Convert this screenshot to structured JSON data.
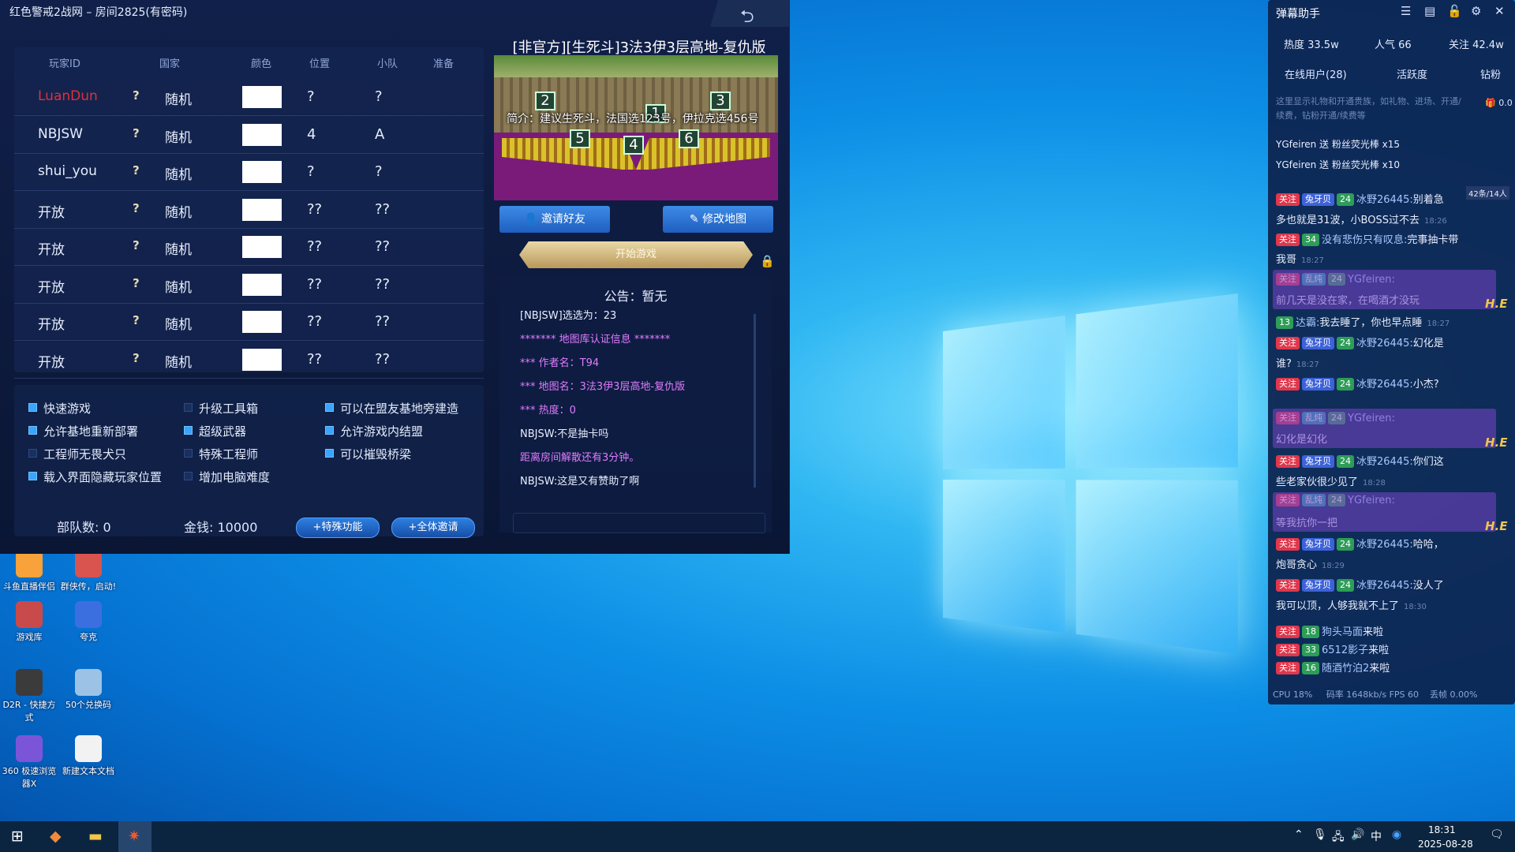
{
  "game": {
    "title": "红色警戒2战网 – 房间2825(有密码)",
    "columns": [
      "玩家ID",
      "国家",
      "颜色",
      "位置",
      "小队",
      "准备"
    ],
    "players": [
      {
        "id": "LuanDun",
        "flag": "?",
        "nation": "随机",
        "pos": "?",
        "team": "?"
      },
      {
        "id": "NBJSW",
        "flag": "?",
        "nation": "随机",
        "pos": "4",
        "team": "A"
      },
      {
        "id": "shui_you",
        "flag": "?",
        "nation": "随机",
        "pos": "?",
        "team": "?"
      },
      {
        "id": "开放",
        "flag": "?",
        "nation": "随机",
        "pos": "??",
        "team": "??"
      },
      {
        "id": "开放",
        "flag": "?",
        "nation": "随机",
        "pos": "??",
        "team": "??"
      },
      {
        "id": "开放",
        "flag": "?",
        "nation": "随机",
        "pos": "??",
        "team": "??"
      },
      {
        "id": "开放",
        "flag": "?",
        "nation": "随机",
        "pos": "??",
        "team": "??"
      },
      {
        "id": "开放",
        "flag": "?",
        "nation": "随机",
        "pos": "??",
        "team": "??"
      }
    ],
    "options": [
      {
        "label": "快速游戏",
        "on": true
      },
      {
        "label": "升级工具箱",
        "on": false
      },
      {
        "label": "可以在盟友基地旁建造",
        "on": true
      },
      {
        "label": "允许基地重新部署",
        "on": true
      },
      {
        "label": "超级武器",
        "on": true
      },
      {
        "label": "允许游戏内结盟",
        "on": true
      },
      {
        "label": "工程师无畏犬只",
        "on": false
      },
      {
        "label": "特殊工程师",
        "on": false
      },
      {
        "label": "可以摧毁桥梁",
        "on": true
      },
      {
        "label": "载入界面隐藏玩家位置",
        "on": true
      },
      {
        "label": "增加电脑难度",
        "on": false
      }
    ],
    "units": "部队数:  0",
    "money": "金钱:  10000",
    "special_btn": "+特殊功能",
    "invite_all_btn": "+全体邀请",
    "map_title": "[非官方][生死斗]3法3伊3层高地-复仇版",
    "map_desc": "简介：建议生死斗，法国选123号，伊拉克选456号",
    "map_numbers": [
      "2",
      "1",
      "3",
      "5",
      "4",
      "6"
    ],
    "invite_btn": "邀请好友",
    "edit_map_btn": "修改地图",
    "start_btn": "开始游戏",
    "notice": "公告：暂无",
    "chat": [
      {
        "text": "[NBJSW]选选为：23",
        "cls": "white"
      },
      {
        "text": "******* 地图库认证信息 *******",
        "cls": "pink"
      },
      {
        "text": "*** 作者名：T94",
        "cls": "pink"
      },
      {
        "text": "*** 地图名：3法3伊3层高地-复仇版",
        "cls": "pink"
      },
      {
        "text": "*** 热度：0",
        "cls": "pink"
      },
      {
        "text": "NBJSW:不是抽卡吗",
        "cls": "white"
      },
      {
        "text": "距离房间解散还有3分钟。",
        "cls": "pink"
      },
      {
        "text": "NBJSW:这是又有赞助了啊",
        "cls": "white"
      }
    ]
  },
  "desktop": {
    "icons": [
      {
        "label": "斗鱼直播伴侣",
        "color": "#f7a23a"
      },
      {
        "label": "群侠传，启动!",
        "color": "#d9534f"
      },
      {
        "label": "游戏库",
        "color": "#c94a4a"
      },
      {
        "label": "夸克",
        "color": "#3b6fe0"
      },
      {
        "label": "D2R - 快捷方式",
        "color": "#3b3b3b"
      },
      {
        "label": "50个兑换码",
        "color": "#9cc3e6"
      },
      {
        "label": "360 极速浏览器X",
        "color": "#7b55d8"
      },
      {
        "label": "新建文本文档",
        "color": "#f2f2f2"
      }
    ]
  },
  "danmu": {
    "title": "弹幕助手",
    "stats": [
      "热度 33.5w",
      "人气 66",
      "关注 42.4w"
    ],
    "tabs": [
      "在线用户(28)",
      "活跃度",
      "钻粉"
    ],
    "counter": "42条/14人",
    "gift_count": "0.0",
    "notice": "这里显示礼物和开通贵族，如礼物、进场、开通/续费，钻粉开通/续费等",
    "gifts": [
      "YGfeiren 送 粉丝荧光棒 x15",
      "YGfeiren 送 粉丝荧光棒 x10"
    ],
    "messages": [
      {
        "tag": "关注",
        "badge": "兔牙贝",
        "lv": "24",
        "user": "冰野26445:",
        "text": "别着急",
        "time": ""
      },
      {
        "tag": "",
        "badge": "",
        "lv": "",
        "user": "",
        "text": "多也就是31波，小BOSS过不去",
        "time": "18:26"
      },
      {
        "tag": "关注",
        "badge": "",
        "lv": "34",
        "user": "没有悲伤只有叹息:",
        "text": "完事抽卡带",
        "time": ""
      },
      {
        "tag": "",
        "badge": "",
        "lv": "",
        "user": "",
        "text": "我哥",
        "time": "18:27"
      },
      {
        "tag": "关注",
        "badge": "乱炖",
        "lv": "24",
        "user": "YGfeiren:",
        "text": "",
        "time": ""
      },
      {
        "tag": "",
        "badge": "",
        "lv": "",
        "user": "",
        "text": "前几天是没在家，在喝酒才没玩",
        "time": ""
      },
      {
        "tag": "",
        "badge": "",
        "lv": "13",
        "user": "达霸:",
        "text": "我去睡了，你也早点睡",
        "time": "18:27"
      },
      {
        "tag": "关注",
        "badge": "兔牙贝",
        "lv": "24",
        "user": "冰野26445:",
        "text": "幻化是",
        "time": ""
      },
      {
        "tag": "",
        "badge": "",
        "lv": "",
        "user": "",
        "text": "谁?",
        "time": "18:27"
      },
      {
        "tag": "关注",
        "badge": "兔牙贝",
        "lv": "24",
        "user": "冰野26445:",
        "text": "小杰?",
        "time": ""
      },
      {
        "tag": "关注",
        "badge": "乱炖",
        "lv": "24",
        "user": "YGfeiren:",
        "text": "",
        "time": ""
      },
      {
        "tag": "",
        "badge": "",
        "lv": "",
        "user": "",
        "text": "幻化是幻化",
        "time": ""
      },
      {
        "tag": "关注",
        "badge": "兔牙贝",
        "lv": "24",
        "user": "冰野26445:",
        "text": "你们这",
        "time": ""
      },
      {
        "tag": "",
        "badge": "",
        "lv": "",
        "user": "",
        "text": "些老家伙很少见了",
        "time": "18:28"
      },
      {
        "tag": "关注",
        "badge": "乱炖",
        "lv": "24",
        "user": "YGfeiren:",
        "text": "",
        "time": ""
      },
      {
        "tag": "",
        "badge": "",
        "lv": "",
        "user": "",
        "text": "等我抗你一把",
        "time": ""
      },
      {
        "tag": "关注",
        "badge": "兔牙贝",
        "lv": "24",
        "user": "冰野26445:",
        "text": "哈哈，",
        "time": ""
      },
      {
        "tag": "",
        "badge": "",
        "lv": "",
        "user": "",
        "text": "炮哥贪心",
        "time": "18:29"
      },
      {
        "tag": "关注",
        "badge": "兔牙贝",
        "lv": "24",
        "user": "冰野26445:",
        "text": "没人了",
        "time": ""
      },
      {
        "tag": "",
        "badge": "",
        "lv": "",
        "user": "",
        "text": "我可以顶，人够我就不上了",
        "time": "18:30"
      },
      {
        "tag": "关注",
        "badge": "",
        "lv": "18",
        "user": "狗头马面",
        "text": "来啦",
        "time": ""
      },
      {
        "tag": "关注",
        "badge": "",
        "lv": "33",
        "user": "6512影子",
        "text": "来啦",
        "time": ""
      },
      {
        "tag": "关注",
        "badge": "",
        "lv": "16",
        "user": "随酒竹泊2",
        "text": "来啦",
        "time": ""
      }
    ],
    "footer": [
      "CPU 18%",
      "码率 1648kb/s FPS 60",
      "丢帧 0.00%"
    ]
  },
  "taskbar": {
    "time": "18:31",
    "date": "2025-08-28",
    "ime": "中"
  },
  "colors": {
    "accent": "#3aa4ff",
    "chat_pink": "#e07cff",
    "tag_red": "#e0374c"
  }
}
